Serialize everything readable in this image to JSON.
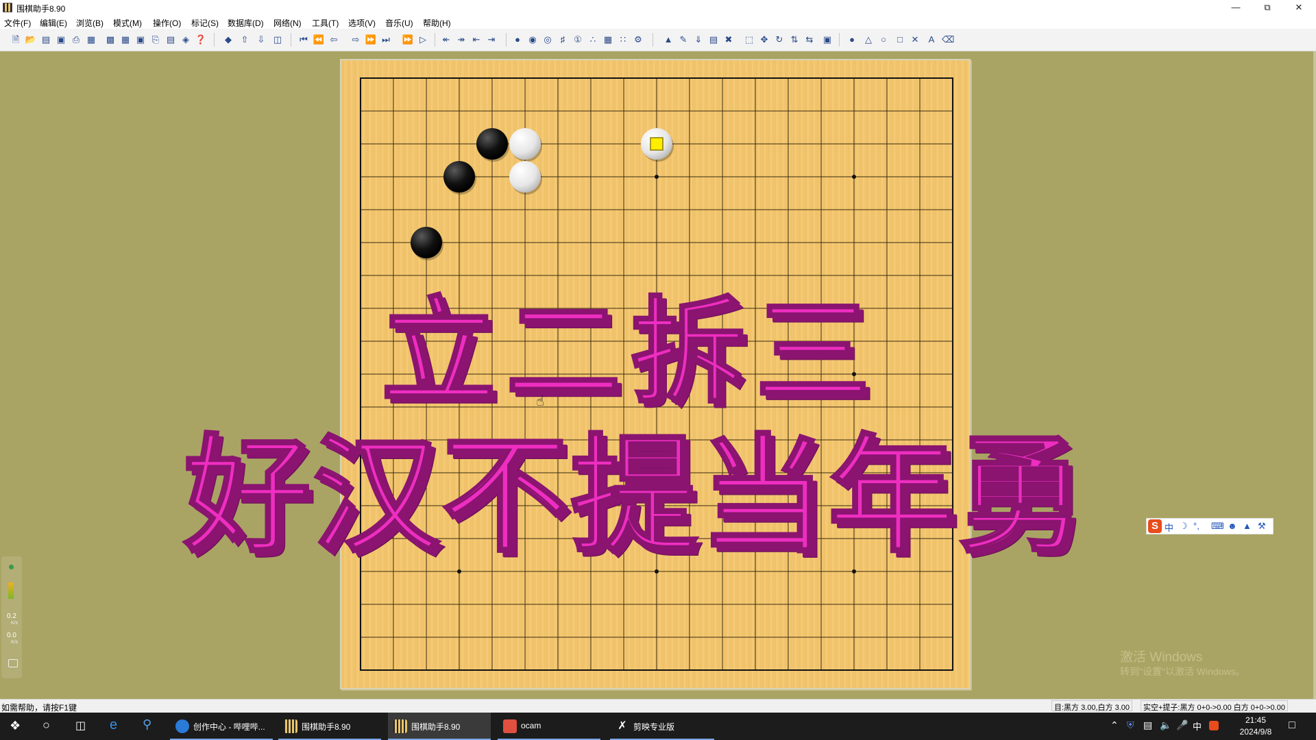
{
  "window": {
    "title": "围棋助手8.90"
  },
  "menu": [
    "文件(F)",
    "编辑(E)",
    "浏览(B)",
    "模式(M)",
    "操作(O)",
    "标记(S)",
    "数据库(D)",
    "网络(N)",
    "工具(T)",
    "选项(V)",
    "音乐(U)",
    "帮助(H)"
  ],
  "toolbar": {
    "file_tools": [
      "new-file",
      "open-file",
      "save-as",
      "save",
      "print",
      "print-preview",
      "board-view",
      "grid-view",
      "image-export",
      "copy",
      "paste",
      "game-info",
      "help"
    ],
    "nav_tools": [
      "book",
      "arrow-up",
      "arrow-down",
      "folder",
      "first",
      "prev-10",
      "prev",
      "next",
      "next-10",
      "last",
      "fast-forward",
      "play"
    ],
    "edit_tools": [
      "branch-prev",
      "branch-next",
      "variation-prev",
      "variation-next"
    ],
    "analysis_tools": [
      "analyze",
      "expand",
      "collapse",
      "move-number",
      "stone-numbers",
      "group",
      "board-grid",
      "diagram",
      "settings"
    ],
    "extra_tools": [
      "stamp",
      "pen",
      "down-arrow",
      "page",
      "delete",
      "select-region",
      "move",
      "rotate",
      "flip-v",
      "swap",
      "zoom-region"
    ],
    "markup_tools": [
      "black-stone",
      "triangle",
      "circle",
      "square",
      "cross",
      "letter-A",
      "eraser"
    ]
  },
  "board": {
    "size": 19,
    "star_points": [
      [
        3,
        3
      ],
      [
        9,
        3
      ],
      [
        15,
        3
      ],
      [
        3,
        9
      ],
      [
        9,
        9
      ],
      [
        15,
        9
      ],
      [
        3,
        15
      ],
      [
        9,
        15
      ],
      [
        15,
        15
      ]
    ],
    "stones": [
      {
        "color": "black",
        "col": 4,
        "row": 2
      },
      {
        "color": "white",
        "col": 5,
        "row": 2
      },
      {
        "color": "black",
        "col": 3,
        "row": 3
      },
      {
        "color": "white",
        "col": 5,
        "row": 3
      },
      {
        "color": "black",
        "col": 2,
        "row": 5
      },
      {
        "color": "white",
        "col": 9,
        "row": 2,
        "marked": true
      }
    ]
  },
  "overlay": {
    "line1": "立二拆三",
    "line2": "好汉不提当年勇"
  },
  "ime_bar": {
    "logo": "S",
    "mode": "中",
    "icons": [
      "moon",
      "punct",
      "keyboard",
      "user",
      "shirt",
      "wrench"
    ]
  },
  "side_widget": {
    "up_speed": "0.2",
    "down_speed": "0.0",
    "unit": "K/s"
  },
  "watermark": {
    "line1": "激活 Windows",
    "line2": "转到\"设置\"以激活 Windows。"
  },
  "statusbar": {
    "help_text": "如需帮助，请按F1键",
    "score": "目:黑方 3.00,白方 3.00",
    "captures": "实空+提子:黑方 0+0->0.00 白方 0+0->0.00"
  },
  "taskbar": {
    "tasks": [
      {
        "label": "创作中心 - 哔哩哔...",
        "color": "#2a7ad8"
      },
      {
        "label": "围棋助手8.90",
        "color": "#d8b040"
      },
      {
        "label": "围棋助手8.90",
        "color": "#d8b040"
      },
      {
        "label": "ocam",
        "color": "#e05040"
      },
      {
        "label": "剪映专业版",
        "color": "#ffffff"
      }
    ],
    "clock_time": "21:45",
    "clock_date": "2024/9/8",
    "ime_indicator": "中"
  }
}
